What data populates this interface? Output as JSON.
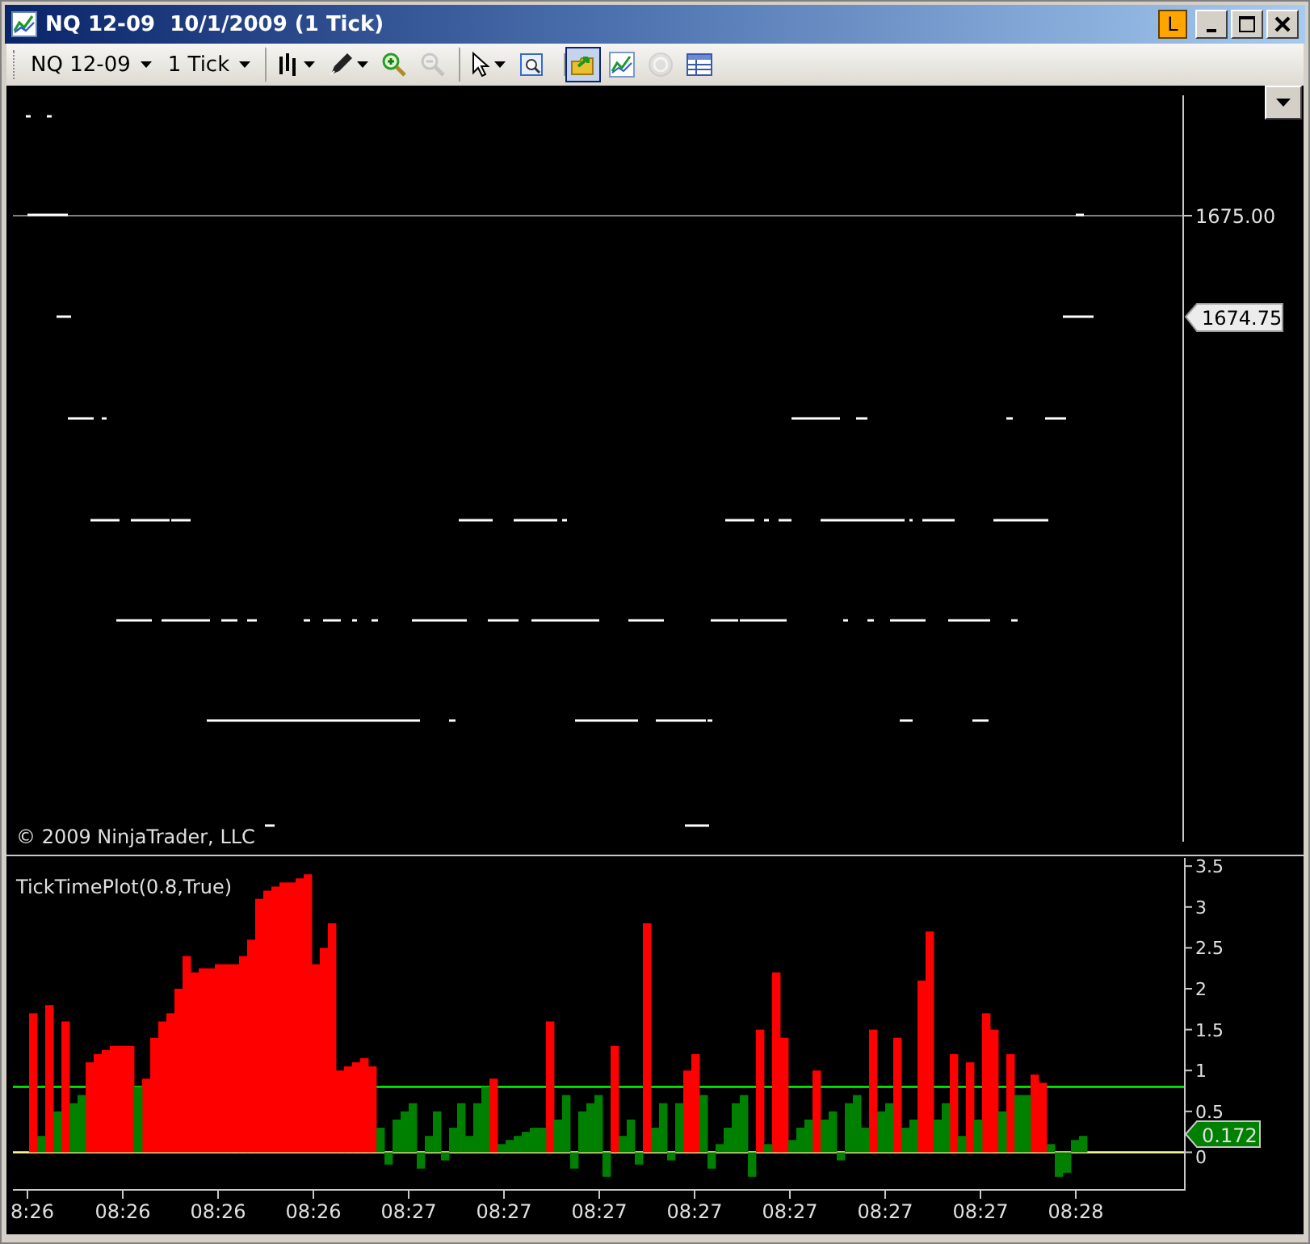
{
  "window": {
    "title": "NQ 12-09  10/1/2009 (1 Tick)",
    "link_button": "L"
  },
  "toolbar": {
    "instrument": "NQ 12-09",
    "interval": "1 Tick",
    "tools": [
      {
        "kind": "bar-style",
        "dropdown": true,
        "disabled": false,
        "pressed": false,
        "separator_before": true
      },
      {
        "kind": "pencil",
        "dropdown": true,
        "disabled": false,
        "pressed": false,
        "separator_before": false
      },
      {
        "kind": "zoom-in",
        "dropdown": false,
        "disabled": false,
        "pressed": false,
        "separator_before": false
      },
      {
        "kind": "zoom-out",
        "dropdown": false,
        "disabled": true,
        "pressed": false,
        "separator_before": false
      },
      {
        "kind": "pointer",
        "dropdown": true,
        "disabled": false,
        "pressed": false,
        "separator_before": true
      },
      {
        "kind": "snapshot",
        "dropdown": false,
        "disabled": false,
        "pressed": false,
        "separator_before": false
      },
      {
        "kind": "properties",
        "dropdown": false,
        "disabled": false,
        "pressed": true,
        "separator_before": true
      },
      {
        "kind": "chart",
        "dropdown": false,
        "disabled": false,
        "pressed": false,
        "separator_before": false
      },
      {
        "kind": "coin",
        "dropdown": false,
        "disabled": true,
        "pressed": false,
        "separator_before": false
      },
      {
        "kind": "table",
        "dropdown": false,
        "disabled": false,
        "pressed": false,
        "separator_before": false
      }
    ]
  },
  "price_panel": {
    "axis_label": "1675.00",
    "last_price": "1674.75",
    "copyright": "© 2009 NinjaTrader, LLC"
  },
  "indicator_panel": {
    "current_value": "0.172",
    "time_labels": [
      "8:26",
      "08:26",
      "08:26",
      "08:26",
      "08:27",
      "08:27",
      "08:27",
      "08:27",
      "08:27",
      "08:27",
      "08:27",
      "08:28"
    ],
    "chart_data": {
      "type": "bar",
      "title": "TickTimePlot(0.8,True)",
      "ylim": [
        -0.45,
        3.64
      ],
      "yticks": [
        0,
        0.5,
        1,
        1.5,
        2,
        2.5,
        3,
        3.5
      ],
      "ref_lines": [
        {
          "axis": "y",
          "value": 0.8,
          "color": "#00ff00"
        },
        {
          "axis": "y",
          "value": 0,
          "color": "#ffffa0"
        }
      ],
      "series": [
        {
          "color": "#ff0000",
          "values": [
            null,
            null,
            1.7,
            null,
            1.8,
            null,
            1.6,
            null,
            null,
            1.1,
            1.2,
            1.25,
            1.3,
            1.3,
            1.3,
            null,
            0.9,
            1.4,
            1.6,
            1.7,
            2.0,
            2.4,
            2.2,
            2.25,
            2.25,
            2.3,
            2.3,
            2.3,
            2.4,
            2.6,
            3.1,
            3.2,
            3.25,
            3.3,
            3.3,
            3.35,
            3.4,
            2.3,
            2.5,
            2.8,
            1.0,
            1.05,
            1.1,
            1.15,
            1.05,
            null,
            null,
            null,
            null,
            null,
            null,
            null,
            null,
            null,
            null,
            null,
            null,
            null,
            null,
            0.9,
            null,
            null,
            null,
            null,
            null,
            null,
            1.6,
            null,
            null,
            null,
            null,
            null,
            null,
            null,
            1.3,
            null,
            null,
            null,
            2.8,
            null,
            null,
            null,
            null,
            1.0,
            1.2,
            null,
            null,
            null,
            null,
            null,
            null,
            null,
            1.5,
            null,
            2.2,
            1.4,
            null,
            null,
            null,
            1.0,
            null,
            null,
            null,
            null,
            null,
            null,
            1.5,
            null,
            null,
            1.4,
            null,
            null,
            2.1,
            2.7,
            null,
            null,
            1.2,
            null,
            1.1,
            null,
            1.7,
            1.5,
            null,
            1.2,
            null,
            null,
            0.95,
            0.85,
            null,
            null,
            null,
            null,
            null,
            null,
            null,
            null,
            null,
            null,
            null,
            null,
            null,
            null,
            null,
            null,
            null
          ]
        },
        {
          "color": "#008000",
          "values": [
            null,
            null,
            null,
            0.2,
            null,
            0.5,
            null,
            0.6,
            0.7,
            null,
            null,
            null,
            null,
            null,
            null,
            0.8,
            null,
            null,
            null,
            null,
            null,
            null,
            null,
            null,
            null,
            null,
            null,
            null,
            null,
            null,
            null,
            null,
            null,
            null,
            null,
            null,
            null,
            null,
            null,
            null,
            null,
            null,
            null,
            null,
            null,
            0.3,
            -0.15,
            0.4,
            0.5,
            0.6,
            -0.2,
            0.2,
            0.5,
            -0.1,
            0.3,
            0.6,
            0.2,
            0.6,
            0.8,
            null,
            0.1,
            0.15,
            0.2,
            0.25,
            0.3,
            0.3,
            null,
            0.4,
            0.7,
            -0.2,
            0.5,
            0.6,
            0.7,
            -0.3,
            null,
            0.2,
            0.4,
            -0.15,
            null,
            0.3,
            0.6,
            -0.1,
            0.6,
            null,
            null,
            0.7,
            -0.2,
            0.1,
            0.3,
            0.6,
            0.7,
            -0.3,
            null,
            0.1,
            null,
            null,
            0.15,
            0.3,
            0.4,
            null,
            0.4,
            0.5,
            -0.1,
            0.6,
            0.7,
            0.3,
            null,
            0.5,
            0.6,
            null,
            0.3,
            0.4,
            null,
            null,
            0.4,
            0.6,
            null,
            0.2,
            null,
            0.4,
            null,
            null,
            0.5,
            null,
            0.7,
            0.7,
            null,
            null,
            0.1,
            -0.3,
            -0.25,
            0.15,
            0.2,
            null,
            null,
            null,
            null,
            null,
            null,
            null,
            null,
            null,
            null,
            null,
            null
          ]
        }
      ]
    }
  }
}
